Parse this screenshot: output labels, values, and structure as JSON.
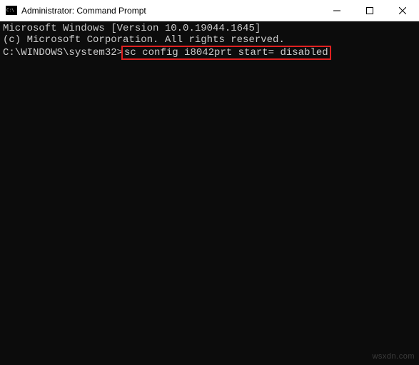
{
  "window": {
    "title": "Administrator: Command Prompt"
  },
  "terminal": {
    "line1": "Microsoft Windows [Version 10.0.19044.1645]",
    "line2": "(c) Microsoft Corporation. All rights reserved.",
    "blank": "",
    "prompt": "C:\\WINDOWS\\system32>",
    "command": "sc config i8042prt start= disabled"
  },
  "watermark": "wsxdn.com"
}
